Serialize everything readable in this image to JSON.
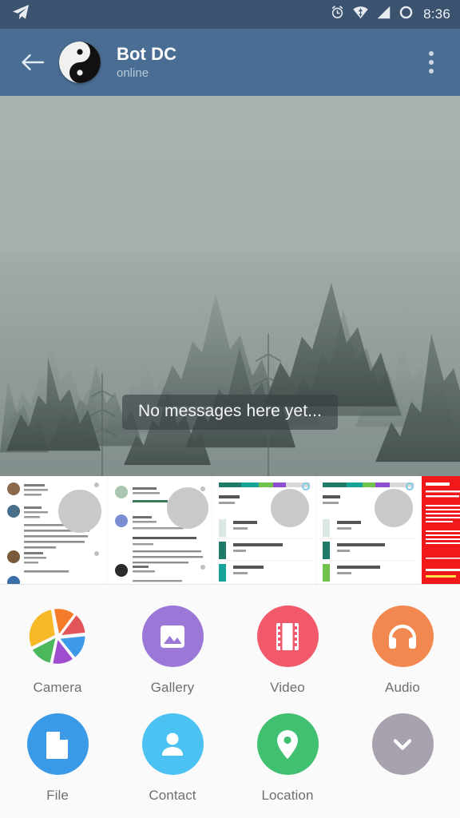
{
  "status_bar": {
    "app_icon": "telegram-paperplane-icon",
    "icons": [
      "alarm-clock-icon",
      "wifi-icon",
      "cellular-signal-icon",
      "battery-ring-icon"
    ],
    "time": "8:36",
    "background_color": "#3c5370"
  },
  "app_bar": {
    "back_icon": "back-arrow-icon",
    "avatar": "yin-yang-avatar",
    "title": "Bot DC",
    "status": "online",
    "overflow_icon": "more-vertical-icon",
    "background_color": "#4a6d94"
  },
  "chat": {
    "empty_text": "No messages here yet...",
    "wallpaper": "foggy-forest-wallpaper"
  },
  "photo_strip": {
    "thumbnails": [
      {
        "name": "app-reviews-screenshot",
        "kind": "reviews"
      },
      {
        "name": "app-reviews-english-screenshot",
        "kind": "reviews2"
      },
      {
        "name": "storage-usage-screenshot",
        "kind": "storage"
      },
      {
        "name": "storage-usage-screenshot-2",
        "kind": "storage"
      },
      {
        "name": "browser-warning-screenshot",
        "kind": "warning"
      }
    ]
  },
  "attachments": {
    "rows": [
      [
        {
          "label": "Camera",
          "icon": "camera-shutter-icon",
          "color": "#ffffff"
        },
        {
          "label": "Gallery",
          "icon": "photo-icon",
          "color": "#9b78d8"
        },
        {
          "label": "Video",
          "icon": "film-strip-icon",
          "color": "#f2596b"
        },
        {
          "label": "Audio",
          "icon": "headphones-icon",
          "color": "#f2884f"
        }
      ],
      [
        {
          "label": "File",
          "icon": "document-icon",
          "color": "#3a9ae8"
        },
        {
          "label": "Contact",
          "icon": "person-icon",
          "color": "#4cc2f2"
        },
        {
          "label": "Location",
          "icon": "map-pin-icon",
          "color": "#40c070"
        },
        {
          "label": "",
          "icon": "chevron-down-icon",
          "color": "#a8a2ae"
        }
      ]
    ],
    "camera_colors": [
      "#f47b2a",
      "#e4555a",
      "#3d9ae8",
      "#a04ccf",
      "#4cb85c",
      "#f7b928"
    ],
    "panel_background": "#fafafa",
    "label_color": "#6f6f6f"
  }
}
